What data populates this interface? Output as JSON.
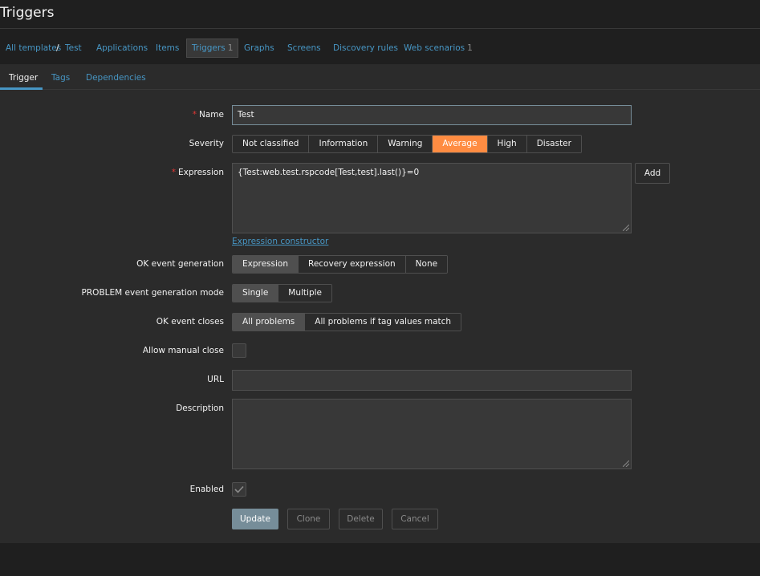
{
  "page": {
    "title": "Triggers"
  },
  "nav": {
    "all_templates": "All templates",
    "separator": "/",
    "template": "Test",
    "applications": "Applications",
    "items": "Items",
    "triggers": "Triggers",
    "triggers_count": "1",
    "graphs": "Graphs",
    "screens": "Screens",
    "discovery_rules": "Discovery rules",
    "web_scenarios": "Web scenarios",
    "web_scenarios_count": "1"
  },
  "tabs": {
    "trigger": "Trigger",
    "tags": "Tags",
    "dependencies": "Dependencies"
  },
  "form": {
    "required_mark": "*",
    "name_label": "Name",
    "name_value": "Test",
    "severity_label": "Severity",
    "severity_options": [
      "Not classified",
      "Information",
      "Warning",
      "Average",
      "High",
      "Disaster"
    ],
    "severity_selected": "Average",
    "expression_label": "Expression",
    "expression_value": "{Test:web.test.rspcode[Test,test].last()}=0",
    "add_button": "Add",
    "expression_constructor": "Expression constructor",
    "ok_event_generation_label": "OK event generation",
    "ok_event_generation_options": [
      "Expression",
      "Recovery expression",
      "None"
    ],
    "ok_event_generation_selected": "Expression",
    "problem_mode_label": "PROBLEM event generation mode",
    "problem_mode_options": [
      "Single",
      "Multiple"
    ],
    "problem_mode_selected": "Single",
    "ok_event_closes_label": "OK event closes",
    "ok_event_closes_options": [
      "All problems",
      "All problems if tag values match"
    ],
    "ok_event_closes_selected": "All problems",
    "allow_manual_close_label": "Allow manual close",
    "allow_manual_close_checked": false,
    "url_label": "URL",
    "url_value": "",
    "description_label": "Description",
    "description_value": "",
    "enabled_label": "Enabled",
    "enabled_checked": true
  },
  "buttons": {
    "update": "Update",
    "clone": "Clone",
    "delete": "Delete",
    "cancel": "Cancel"
  },
  "colors": {
    "accent": "#4796c4",
    "severity_average": "#ff8c42",
    "required": "#e33734",
    "primary_button": "#768d99"
  }
}
